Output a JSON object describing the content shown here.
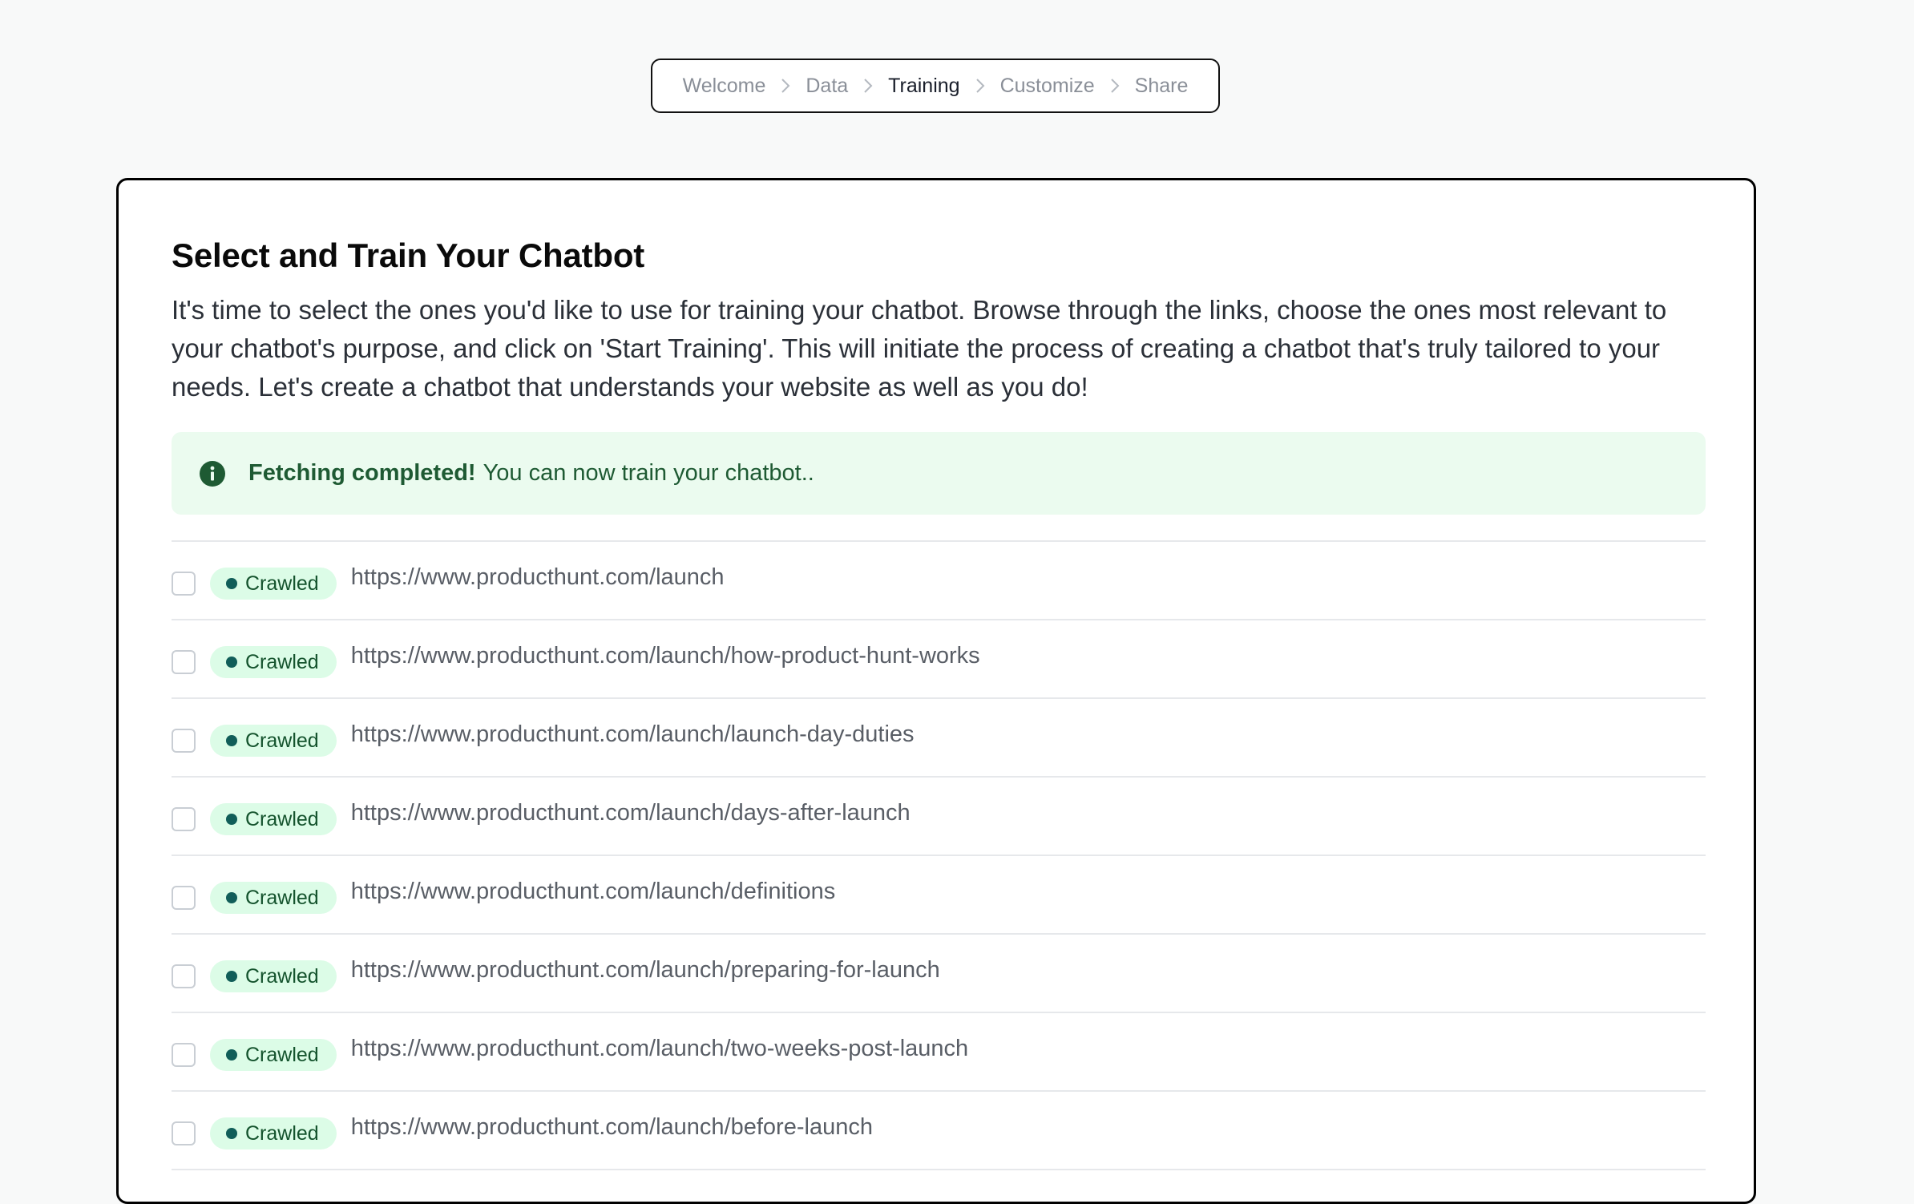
{
  "stepper": {
    "steps": [
      {
        "label": "Welcome"
      },
      {
        "label": "Data"
      },
      {
        "label": "Training"
      },
      {
        "label": "Customize"
      },
      {
        "label": "Share"
      }
    ],
    "active_step": "Training"
  },
  "card": {
    "title": "Select and Train Your Chatbot",
    "description": "It's time to select the ones you'd like to use for training your chatbot. Browse through the links, choose the ones most relevant to your chatbot's purpose, and click on 'Start Training'. This will initiate the process of creating a chatbot that's truly tailored to your needs. Let's create a chatbot that understands your website as well as you do!",
    "alert": {
      "icon": "info-icon",
      "strong": "Fetching completed!",
      "text": "You can now train your chatbot.."
    },
    "links": [
      {
        "status": "Crawled",
        "url": "https://www.producthunt.com/launch",
        "checked": false
      },
      {
        "status": "Crawled",
        "url": "https://www.producthunt.com/launch/how-product-hunt-works",
        "checked": false
      },
      {
        "status": "Crawled",
        "url": "https://www.producthunt.com/launch/launch-day-duties",
        "checked": false
      },
      {
        "status": "Crawled",
        "url": "https://www.producthunt.com/launch/days-after-launch",
        "checked": false
      },
      {
        "status": "Crawled",
        "url": "https://www.producthunt.com/launch/definitions",
        "checked": false
      },
      {
        "status": "Crawled",
        "url": "https://www.producthunt.com/launch/preparing-for-launch",
        "checked": false
      },
      {
        "status": "Crawled",
        "url": "https://www.producthunt.com/launch/two-weeks-post-launch",
        "checked": false
      },
      {
        "status": "Crawled",
        "url": "https://www.producthunt.com/launch/before-launch",
        "checked": false
      }
    ]
  },
  "colors": {
    "page_background": "#f8f9f9",
    "alert_background": "#ebfbef",
    "badge_background": "#dcfce7",
    "badge_dot": "#115e59"
  }
}
